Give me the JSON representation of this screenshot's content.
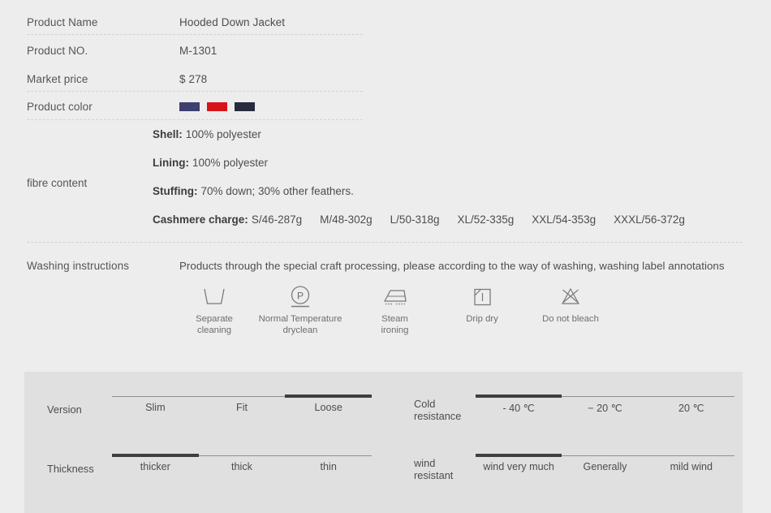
{
  "spec": {
    "rows": [
      {
        "label": "Product  Name",
        "value": "Hooded  Down Jacket"
      },
      {
        "label": "Product NO.",
        "value": "M-1301"
      },
      {
        "label": "Market price",
        "value": "$ 278"
      },
      {
        "label": "Product color",
        "value": ""
      }
    ],
    "colors": [
      {
        "name": "navy-blue",
        "hex": "#3d3f6e"
      },
      {
        "name": "red",
        "hex": "#d8141b"
      },
      {
        "name": "dark-navy",
        "hex": "#262b3d"
      }
    ]
  },
  "fibre": {
    "label": "fibre content",
    "lines": [
      {
        "key": "Shell:",
        "text": "100% polyester"
      },
      {
        "key": "Lining:",
        "text": "100% polyester"
      },
      {
        "key": "Stuffing:",
        "text": "70% down; 30% other feathers."
      }
    ],
    "cashmere_key": "Cashmere charge:",
    "cashmere_sizes": [
      "S/46-287g",
      "M/48-302g",
      "L/50-318g",
      "XL/52-335g",
      "XXL/54-353g",
      "XXXL/56-372g"
    ]
  },
  "washing": {
    "label": "Washing instructions",
    "description": "Products through the special craft processing, please according to the way of washing, washing label annotations",
    "icons": [
      {
        "icon": "washtub-icon",
        "caption": "Separate\ncleaning"
      },
      {
        "icon": "dryclean-p-icon",
        "caption": "Normal Temperature\ndryclean"
      },
      {
        "icon": "steam-iron-icon",
        "caption": "Steam\nironing"
      },
      {
        "icon": "drip-dry-icon",
        "caption": "Drip dry"
      },
      {
        "icon": "do-not-bleach-icon",
        "caption": "Do not bleach"
      }
    ]
  },
  "gauges": [
    {
      "name": "Version",
      "labels": [
        "Slim",
        "Fit",
        "Loose"
      ],
      "active_index": 2
    },
    {
      "name": "Cold\nresistance",
      "labels": [
        "- 40 ℃",
        "− 20 ℃",
        "20 ℃"
      ],
      "active_index": 0
    },
    {
      "name": "Thickness",
      "labels": [
        "thicker",
        "thick",
        "thin"
      ],
      "active_index": 0
    },
    {
      "name": "wind\nresistant",
      "labels": [
        "wind very much",
        "Generally",
        "mild wind"
      ],
      "active_index": 0
    }
  ],
  "colors_meta": {
    "page_background": "#ededed",
    "panel_background": "#e0e0e0",
    "track_inactive": "#8f8f8f",
    "track_active": "#3f3f3f",
    "separator": "#d2d2d2"
  }
}
